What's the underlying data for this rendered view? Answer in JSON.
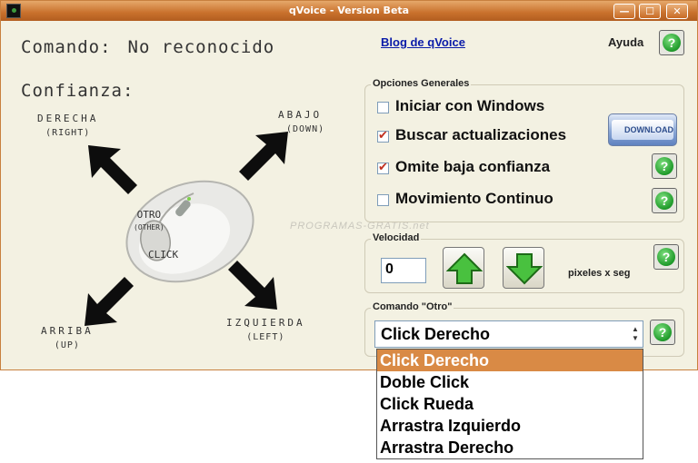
{
  "window": {
    "title": "qVoice - Version Beta",
    "min_glyph": "—",
    "max_glyph": "☐",
    "close_glyph": "✕"
  },
  "header": {
    "comando_label": "Comando:",
    "comando_value": "No reconocido",
    "blog_link": "Blog de qVoice",
    "ayuda_label": "Ayuda"
  },
  "help_glyph": "?",
  "confianza_label": "Confianza:",
  "directions": {
    "derecha": "DERECHA",
    "derecha_sub": "(RIGHT)",
    "abajo": "ABAJO",
    "abajo_sub": "(DOWN)",
    "arriba": "ARRIBA",
    "arriba_sub": "(UP)",
    "izquierda": "IZQUIERDA",
    "izquierda_sub": "(LEFT)",
    "otro": "OTRO",
    "otro_sub": "(OTHER)",
    "click": "CLICK"
  },
  "watermark": "PROGRAMAS-GRATIS.net",
  "opciones": {
    "title": "Opciones Generales",
    "items": [
      {
        "label": "Iniciar con Windows",
        "checked": false
      },
      {
        "label": "Buscar actualizaciones",
        "checked": true
      },
      {
        "label": "Omite baja confianza",
        "checked": true
      },
      {
        "label": "Movimiento Continuo",
        "checked": false
      }
    ],
    "download_label": "DOWNLOAD"
  },
  "velocidad": {
    "title": "Velocidad",
    "value": "0",
    "unit_label": "pixeles x seg"
  },
  "comando_otro": {
    "title": "Comando \"Otro\"",
    "selected": "Click Derecho",
    "options": [
      "Click Derecho",
      "Doble Click",
      "Click Rueda",
      "Arrastra Izquierdo",
      "Arrastra Derecho"
    ]
  },
  "colors": {
    "accent": "#c8702c",
    "selected_option": "#d98a45",
    "help_green": "#1f9a2a",
    "link": "#0a1ba8"
  }
}
